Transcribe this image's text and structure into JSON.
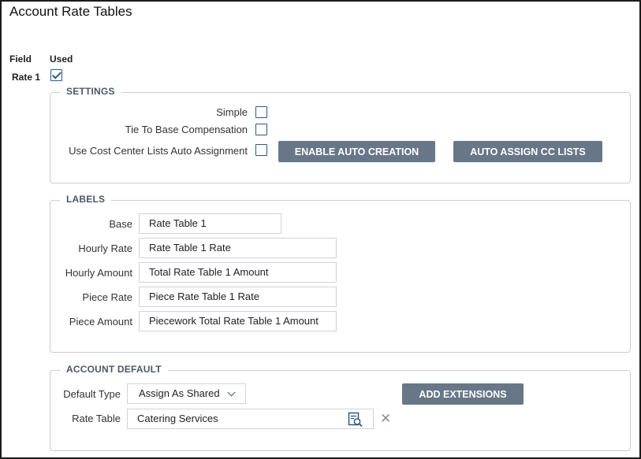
{
  "title": "Account Rate Tables",
  "columns": {
    "field": "Field",
    "used": "Used"
  },
  "row": {
    "label": "Rate 1",
    "used_checked": true
  },
  "settings": {
    "legend": "SETTINGS",
    "simple_label": "Simple",
    "simple_checked": false,
    "tie_label": "Tie To Base Compensation",
    "tie_checked": false,
    "cc_label": "Use Cost Center Lists Auto Assignment",
    "cc_checked": false,
    "enable_auto_creation": "ENABLE AUTO CREATION",
    "auto_assign_cc": "AUTO ASSIGN CC LISTS"
  },
  "labels": {
    "legend": "LABELS",
    "fields": [
      {
        "label": "Base",
        "value": "Rate Table 1"
      },
      {
        "label": "Hourly Rate",
        "value": "Rate Table 1 Rate"
      },
      {
        "label": "Hourly Amount",
        "value": "Total Rate Table 1 Amount"
      },
      {
        "label": "Piece Rate",
        "value": "Piece Rate Table 1 Rate"
      },
      {
        "label": "Piece Amount",
        "value": "Piecework Total Rate Table 1 Amount"
      }
    ]
  },
  "account_default": {
    "legend": "ACCOUNT DEFAULT",
    "default_type_label": "Default Type",
    "default_type_value": "Assign As Shared",
    "add_extensions": "ADD EXTENSIONS",
    "rate_table_label": "Rate Table",
    "rate_table_value": "Catering Services",
    "clear_glyph": "✕"
  },
  "colors": {
    "button_bg": "#677787",
    "accent": "#2c5a86",
    "border": "#c9cdd2"
  }
}
